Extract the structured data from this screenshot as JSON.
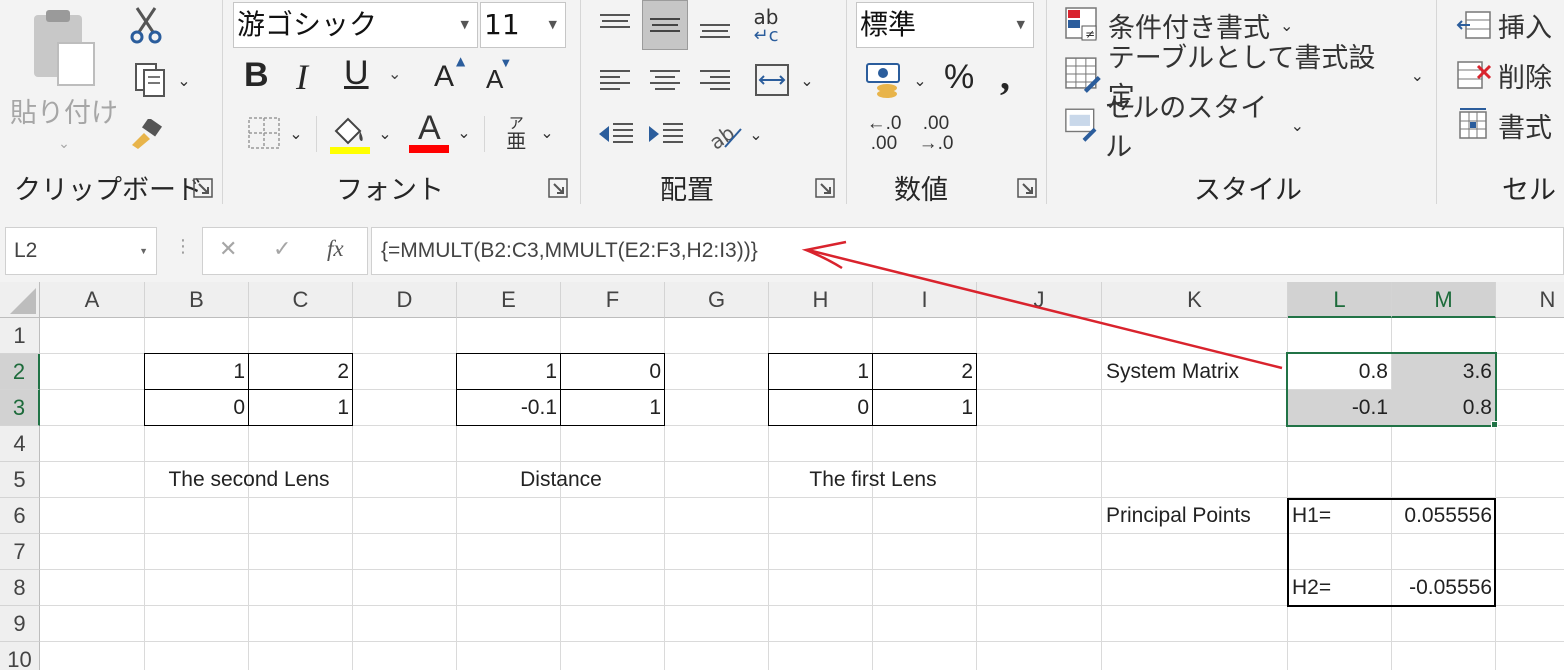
{
  "ribbon": {
    "clipboard": {
      "paste_label": "貼り付け",
      "group_label": "クリップボード"
    },
    "font": {
      "font_name": "游ゴシック",
      "font_size": "11",
      "bold": "B",
      "italic": "I",
      "underline": "U",
      "grow": "A",
      "shrink": "A",
      "font_color_glyph": "A",
      "phonetic_top": "ア",
      "phonetic_bottom": "亜",
      "group_label": "フォント",
      "fill_color": "#ffff00",
      "text_color": "#ff0000"
    },
    "alignment": {
      "orientation_glyph": "ab",
      "group_label": "配置"
    },
    "number": {
      "format": "標準",
      "percent": "%",
      "comma": ",",
      "inc_top": "←.0",
      "inc_bottom": ".00",
      "dec_top": ".00",
      "dec_bottom": "→.0",
      "group_label": "数値"
    },
    "styles": {
      "conditional": "条件付き書式",
      "as_table": "テーブルとして書式設定",
      "cell_styles": "セルのスタイル",
      "group_label": "スタイル"
    },
    "cells": {
      "insert": "挿入",
      "delete": "削除",
      "format": "書式",
      "group_label": "セル"
    }
  },
  "formula_bar": {
    "name_box": "L2",
    "cancel": "✕",
    "enter": "✓",
    "fx": "fx",
    "formula": "{=MMULT(B2:C3,MMULT(E2:F3,H2:I3))}"
  },
  "sheet": {
    "columns": [
      "A",
      "B",
      "C",
      "D",
      "E",
      "F",
      "G",
      "H",
      "I",
      "J",
      "K",
      "L",
      "M",
      "N"
    ],
    "rows": [
      "1",
      "2",
      "3",
      "4",
      "5",
      "6",
      "7",
      "8",
      "9",
      "10"
    ],
    "selected_cell": "L2",
    "cells": {
      "B2": "1",
      "C2": "2",
      "B3": "0",
      "C3": "1",
      "E2": "1",
      "F2": "0",
      "E3": "-0.1",
      "F3": "1",
      "H2": "1",
      "I2": "2",
      "H3": "0",
      "I3": "1",
      "B5": "The second Lens",
      "E5": "Distance",
      "H5": "The first Lens",
      "K2": "System Matrix",
      "L2": "0.8",
      "M2": "3.6",
      "L3": "-0.1",
      "M3": "0.8",
      "K6": "Principal Points",
      "L6": "H1=",
      "M6": "0.055556",
      "L8": "H2=",
      "M8": "-0.05556"
    }
  },
  "colors": {
    "selection_green": "#217346",
    "arrow_red": "#d9232d",
    "header_gray": "#efefef"
  }
}
